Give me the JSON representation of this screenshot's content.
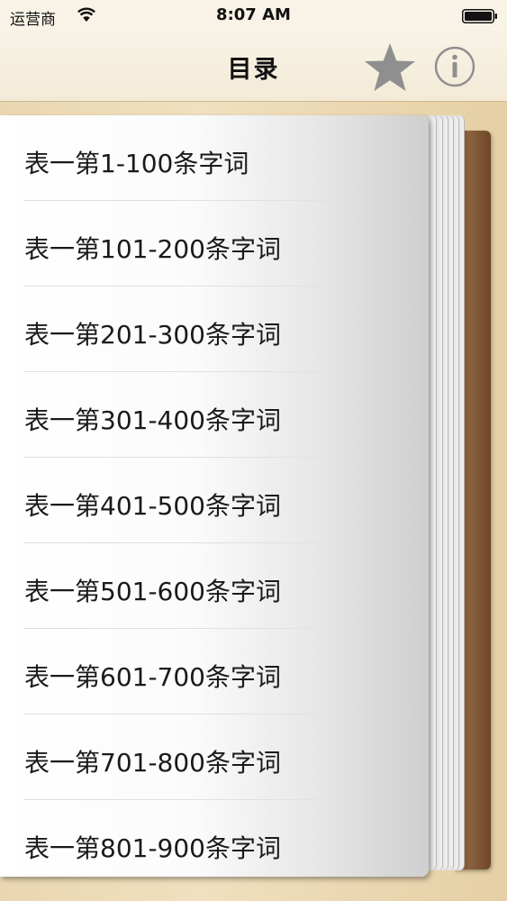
{
  "status_bar": {
    "carrier": "运营商",
    "time": "8:07 AM"
  },
  "nav": {
    "title": "目录",
    "favorites_icon": "star-icon",
    "info_icon": "info-icon",
    "icon_color": "#8f8f8f"
  },
  "toc": {
    "items": [
      {
        "label": "表一第1-100条字词"
      },
      {
        "label": "表一第101-200条字词"
      },
      {
        "label": "表一第201-300条字词"
      },
      {
        "label": "表一第301-400条字词"
      },
      {
        "label": "表一第401-500条字词"
      },
      {
        "label": "表一第501-600条字词"
      },
      {
        "label": "表一第601-700条字词"
      },
      {
        "label": "表一第701-800条字词"
      },
      {
        "label": "表一第801-900条字词"
      }
    ]
  }
}
